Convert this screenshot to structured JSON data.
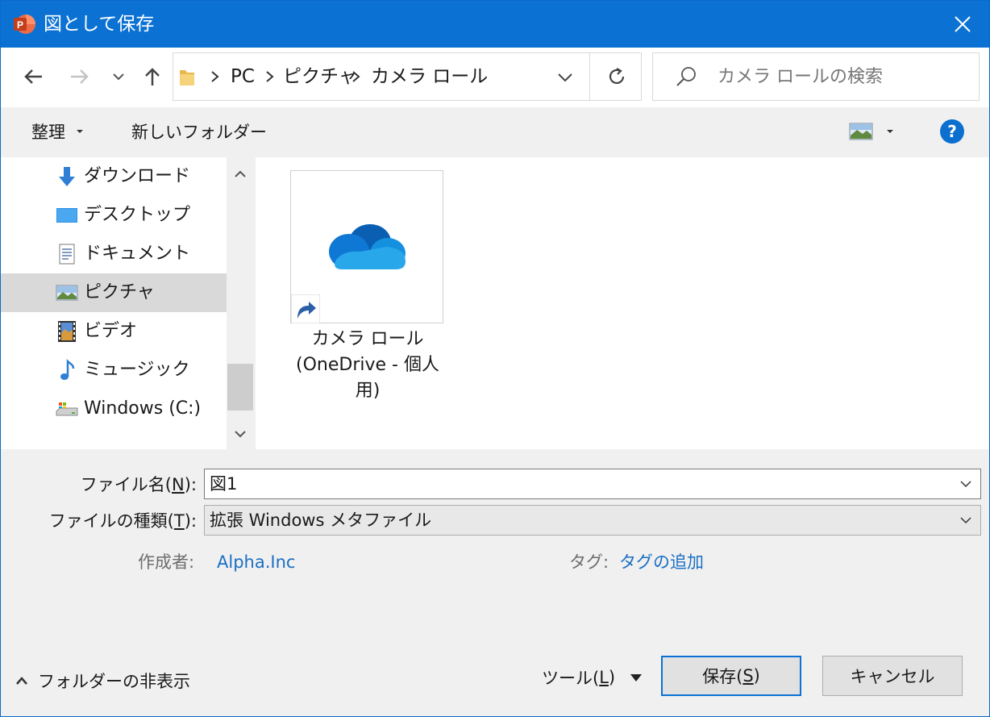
{
  "window": {
    "title": "図として保存"
  },
  "breadcrumb": {
    "items": [
      "PC",
      "ピクチャ",
      "カメラ ロール"
    ]
  },
  "search": {
    "placeholder": "カメラ ロールの検索"
  },
  "toolbar": {
    "organize_label": "整理",
    "new_folder_label": "新しいフォルダー",
    "help_label": "?"
  },
  "sidebar": {
    "items": [
      {
        "label": "ダウンロード",
        "icon": "download-arrow-icon"
      },
      {
        "label": "デスクトップ",
        "icon": "desktop-icon"
      },
      {
        "label": "ドキュメント",
        "icon": "document-icon"
      },
      {
        "label": "ピクチャ",
        "icon": "pictures-icon",
        "selected": true
      },
      {
        "label": "ビデオ",
        "icon": "video-icon"
      },
      {
        "label": "ミュージック",
        "icon": "music-note-icon"
      },
      {
        "label": "Windows (C:)",
        "icon": "drive-icon"
      }
    ]
  },
  "content": {
    "items": [
      {
        "label": "カメラ ロール (OneDrive - 個人用)",
        "icon": "onedrive-cloud-icon",
        "overlay": "shortcut-arrow-icon"
      }
    ]
  },
  "form": {
    "filename_label_prefix": "ファイル名(",
    "filename_label_key": "N",
    "filename_label_suffix": "):",
    "filename_value": "図1",
    "filetype_label_prefix": "ファイルの種類(",
    "filetype_label_key": "T",
    "filetype_label_suffix": "):",
    "filetype_value": "拡張 Windows メタファイル",
    "author_label": "作成者:",
    "author_value": "Alpha.Inc",
    "tags_label": "タグ:",
    "tags_value": "タグの追加"
  },
  "footer": {
    "hide_folders_label": "フォルダーの非表示",
    "tools_prefix": "ツール(",
    "tools_key": "L",
    "tools_suffix": ")",
    "save_prefix": "保存(",
    "save_key": "S",
    "save_suffix": ")",
    "cancel_label": "キャンセル"
  },
  "colors": {
    "titlebar": "#0b72d4",
    "link": "#1a6fc3",
    "selected": "#d9d9d9"
  }
}
